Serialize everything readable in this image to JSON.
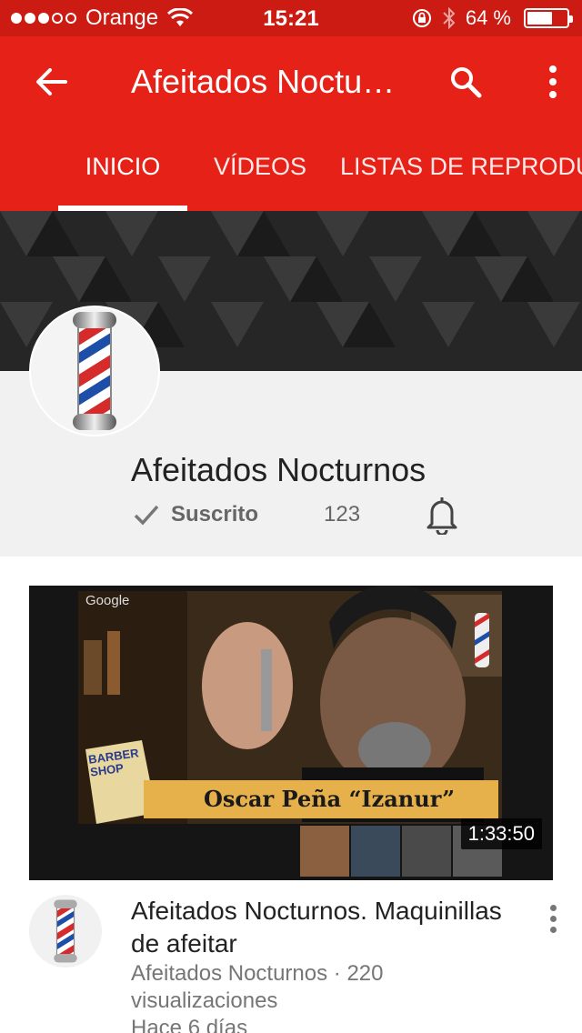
{
  "status_bar": {
    "carrier": "Orange",
    "time": "15:21",
    "battery_percent": "64 %",
    "battery_level": 0.64,
    "signal_bars_filled": 3,
    "signal_bars_total": 5
  },
  "app_bar": {
    "title": "Afeitados Noctu…",
    "back_icon": "arrow-left-icon",
    "search_icon": "search-icon",
    "more_icon": "more-vert-icon"
  },
  "tabs": [
    {
      "label": "INICIO",
      "active": true
    },
    {
      "label": "VÍDEOS",
      "active": false
    },
    {
      "label": "LISTAS DE REPRODUCCIÓN",
      "active": false
    }
  ],
  "channel": {
    "name": "Afeitados Nocturnos",
    "subscribed_label": "Suscrito",
    "subscriber_count": "123",
    "avatar_icon": "barber-pole-icon",
    "bell_icon": "bell-icon",
    "check_icon": "check-icon"
  },
  "video": {
    "duration": "1:33:50",
    "title": "Afeitados Nocturnos. Maquinillas de afeitar",
    "meta_line1": "Afeitados Nocturnos · 220 visualizaciones",
    "meta_line2": "Hace 6 días",
    "thumb_overlay_brand": "Google",
    "thumb_caption": "Oscar Peña “Izanur”",
    "thumb_sign": "BARBER SHOP"
  },
  "colors": {
    "status_bar": "#cc1b12",
    "app_bar": "#e62117",
    "header_bg": "#f1f1f1"
  }
}
